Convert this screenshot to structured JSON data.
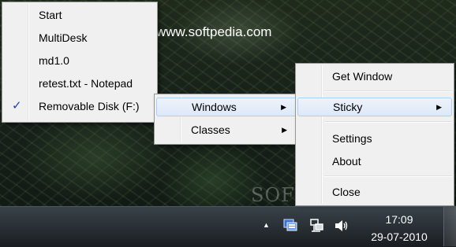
{
  "desktop": {
    "watermark_url": "www.softpedia.com",
    "watermark_logo": "SOFTPEDIA"
  },
  "menu_windows_list": {
    "items": [
      {
        "label": "Start",
        "checked": false
      },
      {
        "label": "MultiDesk",
        "checked": false
      },
      {
        "label": "md1.0",
        "checked": false
      },
      {
        "label": "retest.txt - Notepad",
        "checked": false
      },
      {
        "label": "Removable Disk (F:)",
        "checked": true
      }
    ],
    "check_glyph": "✓"
  },
  "menu_windows_classes": {
    "items": [
      {
        "label": "Windows",
        "submenu": true,
        "highlighted": true
      },
      {
        "label": "Classes",
        "submenu": true,
        "highlighted": false
      }
    ]
  },
  "menu_main": {
    "items": [
      {
        "label": "Get Window"
      },
      {
        "label": "Sticky",
        "submenu": true,
        "highlighted": true
      },
      {
        "label": "Settings"
      },
      {
        "label": "About"
      },
      {
        "label": "Close"
      }
    ]
  },
  "taskbar": {
    "clock_time": "17:09",
    "clock_date": "29-07-2010",
    "tray_icons": [
      "show-hidden-icons-arrow",
      "app-tray-icon",
      "network-icon",
      "volume-icon"
    ]
  },
  "colors": {
    "menu_bg": "#f0f0f0",
    "highlight_border": "#aecff7",
    "taskbar_bg": "#1e252b"
  }
}
